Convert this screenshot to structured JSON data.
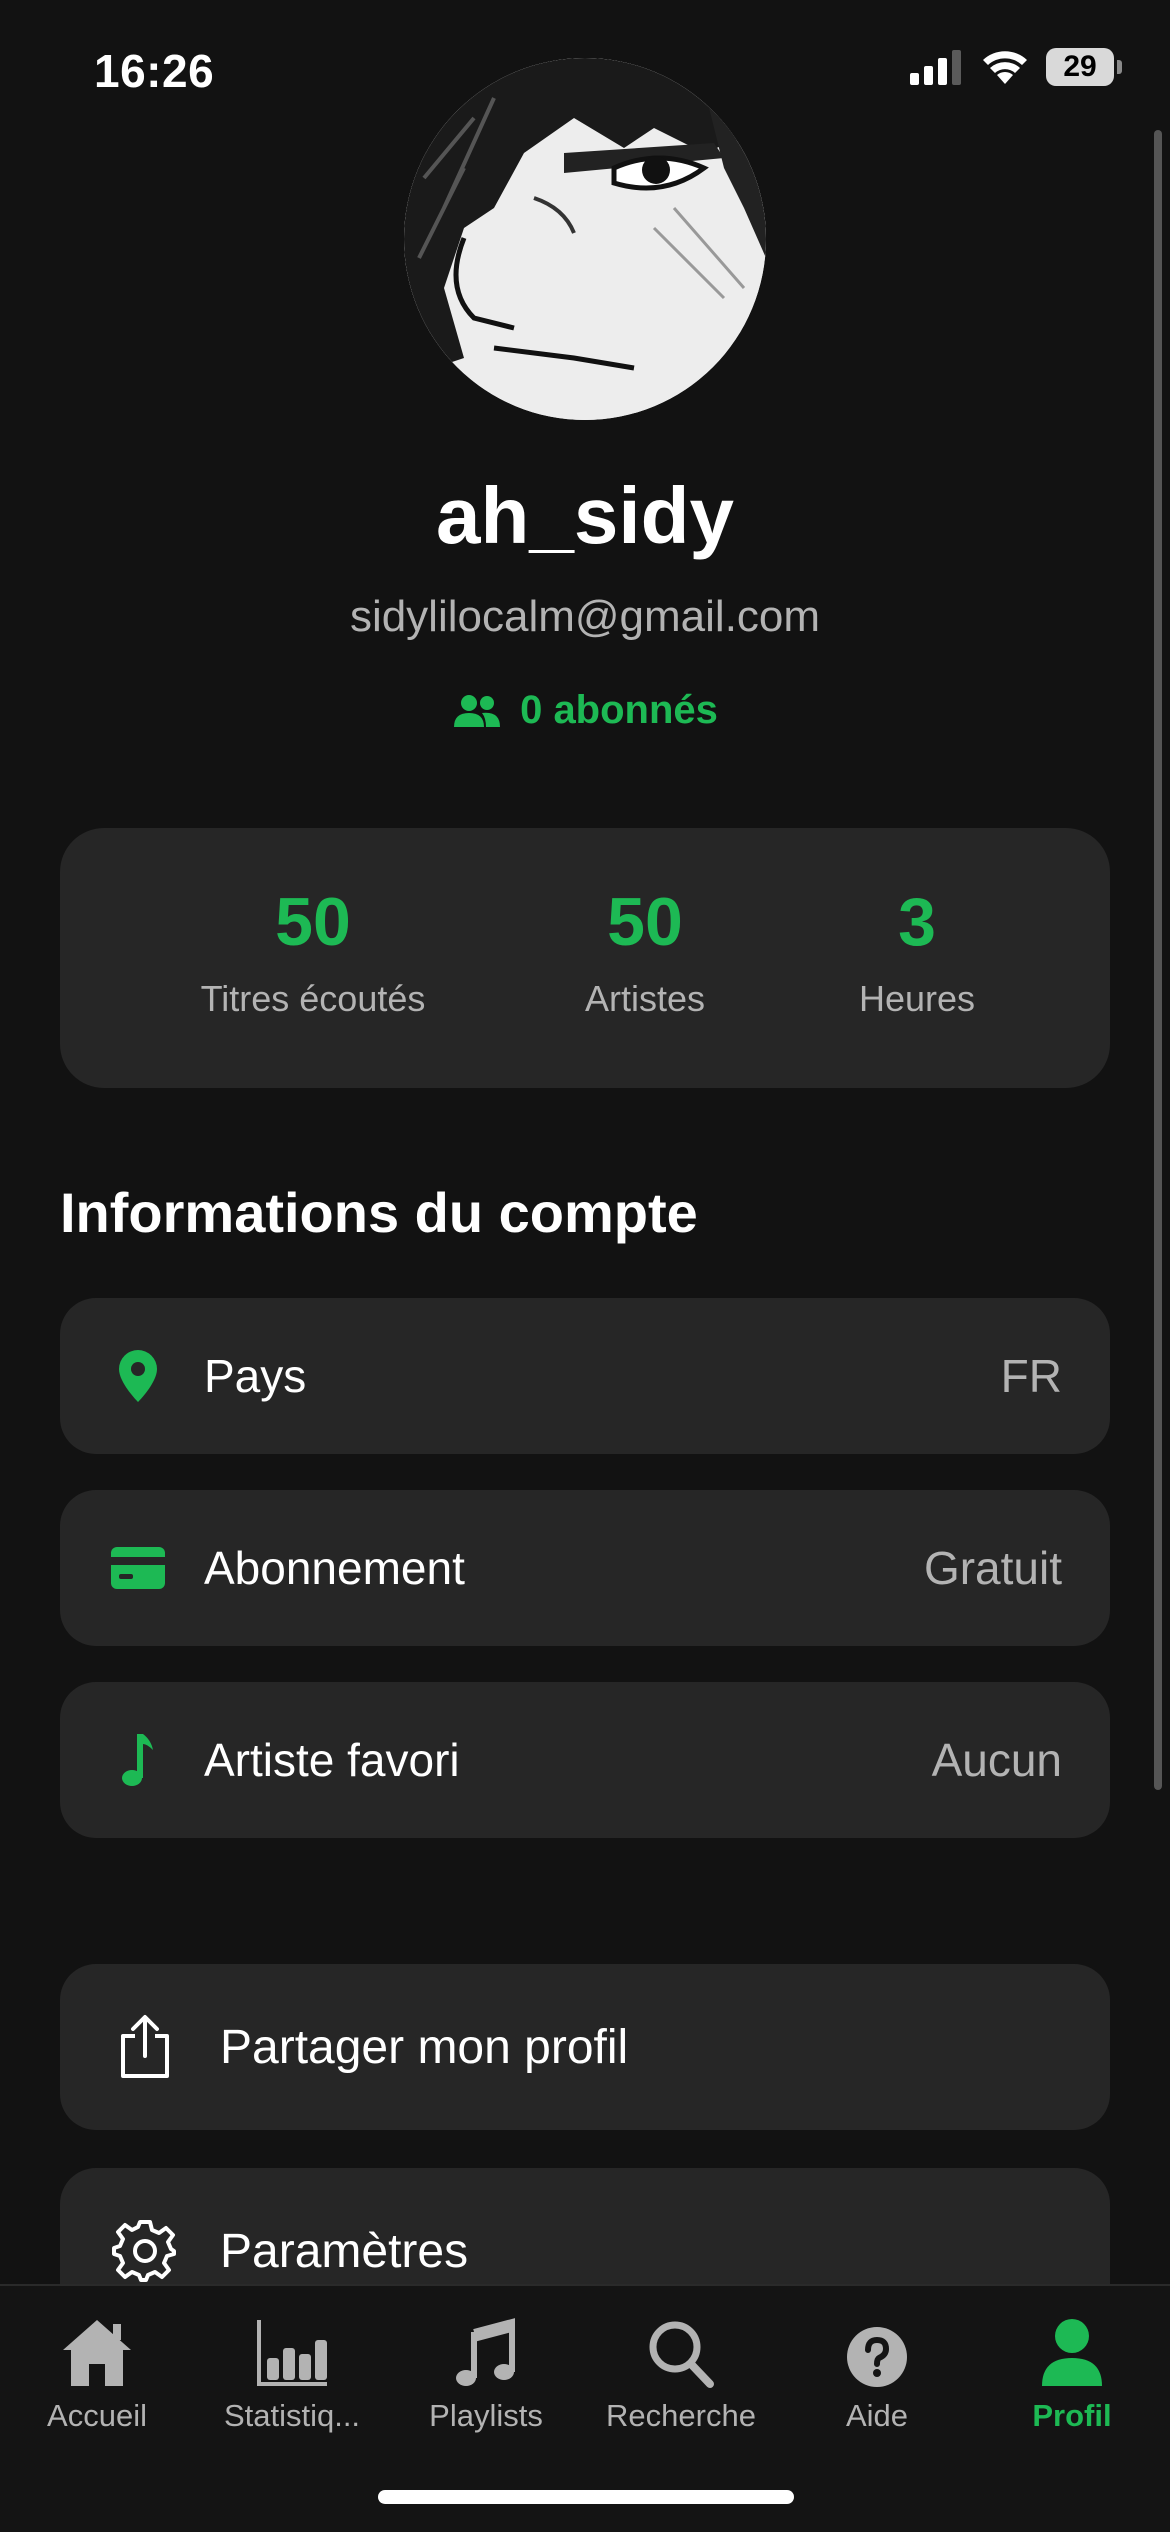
{
  "status_bar": {
    "time": "16:26",
    "battery": "29"
  },
  "profile": {
    "username": "ah_sidy",
    "email": "sidylilocalm@gmail.com",
    "followers": "0 abonnés"
  },
  "stats": [
    {
      "value": "50",
      "label": "Titres écoutés"
    },
    {
      "value": "50",
      "label": "Artistes"
    },
    {
      "value": "3",
      "label": "Heures"
    }
  ],
  "account_section": {
    "title": "Informations du compte",
    "rows": [
      {
        "label": "Pays",
        "value": "FR",
        "icon": "location-pin-icon"
      },
      {
        "label": "Abonnement",
        "value": "Gratuit",
        "icon": "credit-card-icon"
      },
      {
        "label": "Artiste favori",
        "value": "Aucun",
        "icon": "music-note-icon"
      }
    ]
  },
  "actions": [
    {
      "label": "Partager mon profil",
      "icon": "share-icon"
    },
    {
      "label": "Paramètres",
      "icon": "gear-icon"
    }
  ],
  "tabs": [
    {
      "label": "Accueil",
      "icon": "home-icon"
    },
    {
      "label": "Statistiq...",
      "icon": "bar-chart-icon"
    },
    {
      "label": "Playlists",
      "icon": "music-notes-icon"
    },
    {
      "label": "Recherche",
      "icon": "search-icon"
    },
    {
      "label": "Aide",
      "icon": "help-icon"
    },
    {
      "label": "Profil",
      "icon": "profile-icon",
      "active": true
    }
  ],
  "colors": {
    "accent": "#1db954",
    "background": "#121212",
    "card": "#262626",
    "muted_text": "#b3b3b3"
  }
}
